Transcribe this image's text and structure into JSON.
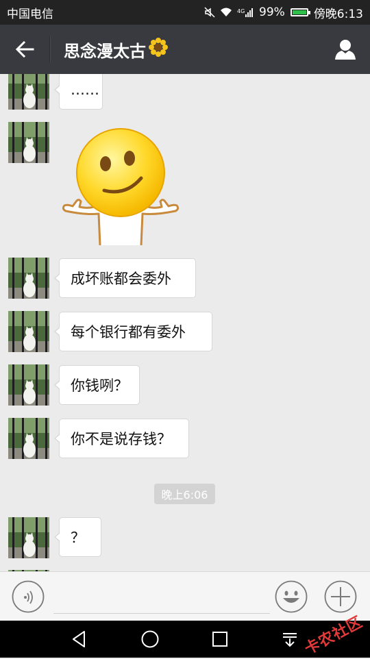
{
  "status_bar": {
    "carrier": "中国电信",
    "network": "4G",
    "battery": "99%",
    "time": "傍晚6:13"
  },
  "header": {
    "title": "思念漫太古",
    "title_emoji": "🌻"
  },
  "messages": [
    {
      "text": "……"
    },
    {
      "text": "成坏账都会委外"
    },
    {
      "text": "每个银行都有委外"
    },
    {
      "text": "你钱咧？"
    },
    {
      "text": "你不是说存钱？"
    },
    {
      "text": "？"
    }
  ],
  "timestamp": "晚上6:06",
  "input": {
    "value": "",
    "placeholder": ""
  },
  "watermark": "卡农社区",
  "colors": {
    "title_bar": "#393a3f",
    "status_bar": "#232323",
    "chat_background": "#ebebeb",
    "bubble": "#ffffff",
    "battery": "#2fbf4b"
  },
  "icons": {
    "back": "arrow-left-icon",
    "profile": "person-icon",
    "voice": "voice-icon",
    "emoji": "smiley-icon",
    "more": "plus-icon",
    "nav_back": "triangle-back-icon",
    "nav_home": "circle-home-icon",
    "nav_recent": "square-recent-icon",
    "nav_down": "pull-down-icon"
  }
}
